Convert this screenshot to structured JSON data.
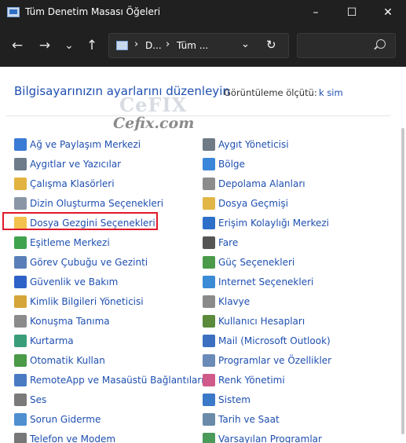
{
  "window": {
    "title": "Tüm Denetim Masası Öğeleri",
    "minimize": "–",
    "maximize": "☐",
    "close": "✕"
  },
  "nav": {
    "back": "←",
    "forward": "→",
    "recent": "⌄",
    "up": "↑",
    "crumb1": "D...",
    "crumb2": "Tüm ...",
    "sep": "›",
    "dropdown": "⌄",
    "refresh": "↻",
    "search_placeholder": ""
  },
  "header": {
    "title": "Bilgisayarınızın ayarlarını düzenleyin",
    "view_by_label": "Görüntüleme ölçütü:",
    "view_by_value": "k sim"
  },
  "watermark": {
    "logo": "CeFIX",
    "text": "Cefix.com"
  },
  "left_items": [
    {
      "label": "Ağ ve Paylaşım Merkezi",
      "icon": "network-icon",
      "color": "#3a7bd5"
    },
    {
      "label": "Aygıtlar ve Yazıcılar",
      "icon": "printer-icon",
      "color": "#6e7c8a"
    },
    {
      "label": "Çalışma Klasörleri",
      "icon": "work-folder-icon",
      "color": "#e3b341"
    },
    {
      "label": "Dizin Oluşturma Seçenekleri",
      "icon": "indexing-icon",
      "color": "#8a96a6"
    },
    {
      "label": "Dosya Gezgini Seçenekleri",
      "icon": "folder-options-icon",
      "color": "#f2c14e"
    },
    {
      "label": "Eşitleme Merkezi",
      "icon": "sync-icon",
      "color": "#3fa34d"
    },
    {
      "label": "Görev Çubuğu ve Gezinti",
      "icon": "taskbar-icon",
      "color": "#5a7fb8"
    },
    {
      "label": "Güvenlik ve Bakım",
      "icon": "flag-icon",
      "color": "#2f62c8"
    },
    {
      "label": "Kimlik Bilgileri Yöneticisi",
      "icon": "credential-icon",
      "color": "#d6a53a"
    },
    {
      "label": "Konuşma Tanıma",
      "icon": "microphone-icon",
      "color": "#8b8b8b"
    },
    {
      "label": "Kurtarma",
      "icon": "recovery-icon",
      "color": "#3a9d7a"
    },
    {
      "label": "Otomatik Kullan",
      "icon": "autoplay-icon",
      "color": "#4a9a48"
    },
    {
      "label": "RemoteApp ve Masaüstü Bağlantıları",
      "icon": "remote-desktop-icon",
      "color": "#4a7ac2"
    },
    {
      "label": "Ses",
      "icon": "speaker-icon",
      "color": "#7a7a7a"
    },
    {
      "label": "Sorun Giderme",
      "icon": "troubleshoot-icon",
      "color": "#4f8fd0"
    },
    {
      "label": "Telefon ve Modem",
      "icon": "phone-icon",
      "color": "#777777"
    }
  ],
  "right_items": [
    {
      "label": "Aygıt Yöneticisi",
      "icon": "device-manager-icon",
      "color": "#6f7b87"
    },
    {
      "label": "Bölge",
      "icon": "globe-icon",
      "color": "#3a86d8"
    },
    {
      "label": "Depolama Alanları",
      "icon": "storage-icon",
      "color": "#8c8c8c"
    },
    {
      "label": "Dosya Geçmişi",
      "icon": "file-history-icon",
      "color": "#e2b646"
    },
    {
      "label": "Erişim Kolaylığı Merkezi",
      "icon": "accessibility-icon",
      "color": "#2e6fc9"
    },
    {
      "label": "Fare",
      "icon": "mouse-icon",
      "color": "#555555"
    },
    {
      "label": "Güç Seçenekleri",
      "icon": "power-icon",
      "color": "#4a9a4a"
    },
    {
      "label": "Internet Seçenekleri",
      "icon": "internet-icon",
      "color": "#3a8ad6"
    },
    {
      "label": "Klavye",
      "icon": "keyboard-icon",
      "color": "#8a8a8a"
    },
    {
      "label": "Kullanıcı Hesapları",
      "icon": "users-icon",
      "color": "#5a8a3a"
    },
    {
      "label": "Mail (Microsoft Outlook)",
      "icon": "mail-icon",
      "color": "#3d6fc0"
    },
    {
      "label": "Programlar ve Özellikler",
      "icon": "programs-icon",
      "color": "#6a8ab8"
    },
    {
      "label": "Renk Yönetimi",
      "icon": "color-management-icon",
      "color": "#d05a8a"
    },
    {
      "label": "Sistem",
      "icon": "system-icon",
      "color": "#3a78c8"
    },
    {
      "label": "Tarih ve Saat",
      "icon": "clock-icon",
      "color": "#6a8aa8"
    },
    {
      "label": "Varsayılan Programlar",
      "icon": "default-programs-icon",
      "color": "#4a9a5a"
    }
  ]
}
